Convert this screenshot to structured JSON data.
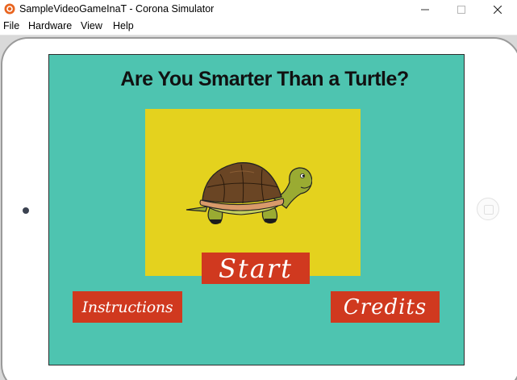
{
  "window": {
    "title": "SampleVideoGameInaT - Corona Simulator",
    "app_icon": "corona-simulator-icon",
    "controls": [
      "minimize-icon",
      "maximize-icon",
      "close-icon"
    ]
  },
  "menubar": {
    "items": [
      {
        "label": "File"
      },
      {
        "label": "Hardware"
      },
      {
        "label": "View"
      },
      {
        "label": "Help"
      }
    ]
  },
  "device": {
    "type": "tablet",
    "icons": [
      "camera-dot",
      "home-button-icon"
    ]
  },
  "game": {
    "title": "Are You Smarter Than a Turtle?",
    "image": "turtle-illustration",
    "buttons": {
      "start": "Start",
      "instructions": "Instructions",
      "credits": "Credits"
    }
  },
  "colors": {
    "screen_background": "#4ec4b0",
    "image_panel": "#e4d21e",
    "button_background": "#d0391f",
    "button_text": "#ffffff",
    "title_text": "#111111"
  }
}
